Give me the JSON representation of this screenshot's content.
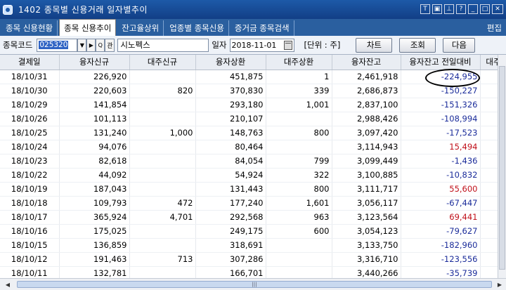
{
  "window": {
    "title": "1402 종목별 신용거래 일자별추이"
  },
  "tabs": [
    {
      "label": "종목 신용현황"
    },
    {
      "label": "종목 신용추이"
    },
    {
      "label": "잔고율상위"
    },
    {
      "label": "업종별 종목신용"
    },
    {
      "label": "증거금 종목검색"
    }
  ],
  "tab_right": "편집",
  "query": {
    "code_label": "종목코드",
    "code_value": "025320",
    "search_btn": "Q",
    "related_btn": "관",
    "stock_name": "시노펙스",
    "date_label": "일자",
    "date_value": "2018-11-01",
    "unit_text": "[단위 : 주]",
    "chart_btn": "차트",
    "query_btn": "조회",
    "next_btn": "다음"
  },
  "table": {
    "headers": [
      "결제일",
      "융자신규",
      "대주신규",
      "융자상환",
      "대주상환",
      "융자잔고",
      "융자잔고 전일대비",
      "대주"
    ],
    "rows": [
      {
        "date": "18/10/31",
        "loan_new": "226,920",
        "short_new": "",
        "loan_repay": "451,875",
        "short_repay": "1",
        "balance": "2,461,918",
        "change": "-224,955",
        "sign": "neg"
      },
      {
        "date": "18/10/30",
        "loan_new": "220,603",
        "short_new": "820",
        "loan_repay": "370,830",
        "short_repay": "339",
        "balance": "2,686,873",
        "change": "-150,227",
        "sign": "neg"
      },
      {
        "date": "18/10/29",
        "loan_new": "141,854",
        "short_new": "",
        "loan_repay": "293,180",
        "short_repay": "1,001",
        "balance": "2,837,100",
        "change": "-151,326",
        "sign": "neg"
      },
      {
        "date": "18/10/26",
        "loan_new": "101,113",
        "short_new": "",
        "loan_repay": "210,107",
        "short_repay": "",
        "balance": "2,988,426",
        "change": "-108,994",
        "sign": "neg"
      },
      {
        "date": "18/10/25",
        "loan_new": "131,240",
        "short_new": "1,000",
        "loan_repay": "148,763",
        "short_repay": "800",
        "balance": "3,097,420",
        "change": "-17,523",
        "sign": "neg"
      },
      {
        "date": "18/10/24",
        "loan_new": "94,076",
        "short_new": "",
        "loan_repay": "80,464",
        "short_repay": "",
        "balance": "3,114,943",
        "change": "15,494",
        "sign": "pos"
      },
      {
        "date": "18/10/23",
        "loan_new": "82,618",
        "short_new": "",
        "loan_repay": "84,054",
        "short_repay": "799",
        "balance": "3,099,449",
        "change": "-1,436",
        "sign": "neg"
      },
      {
        "date": "18/10/22",
        "loan_new": "44,092",
        "short_new": "",
        "loan_repay": "54,924",
        "short_repay": "322",
        "balance": "3,100,885",
        "change": "-10,832",
        "sign": "neg"
      },
      {
        "date": "18/10/19",
        "loan_new": "187,043",
        "short_new": "",
        "loan_repay": "131,443",
        "short_repay": "800",
        "balance": "3,111,717",
        "change": "55,600",
        "sign": "pos"
      },
      {
        "date": "18/10/18",
        "loan_new": "109,793",
        "short_new": "472",
        "loan_repay": "177,240",
        "short_repay": "1,601",
        "balance": "3,056,117",
        "change": "-67,447",
        "sign": "neg"
      },
      {
        "date": "18/10/17",
        "loan_new": "365,924",
        "short_new": "4,701",
        "loan_repay": "292,568",
        "short_repay": "963",
        "balance": "3,123,564",
        "change": "69,441",
        "sign": "pos"
      },
      {
        "date": "18/10/16",
        "loan_new": "175,025",
        "short_new": "",
        "loan_repay": "249,175",
        "short_repay": "600",
        "balance": "3,054,123",
        "change": "-79,627",
        "sign": "neg"
      },
      {
        "date": "18/10/15",
        "loan_new": "136,859",
        "short_new": "",
        "loan_repay": "318,691",
        "short_repay": "",
        "balance": "3,133,750",
        "change": "-182,960",
        "sign": "neg"
      },
      {
        "date": "18/10/12",
        "loan_new": "191,463",
        "short_new": "713",
        "loan_repay": "307,286",
        "short_repay": "",
        "balance": "3,316,710",
        "change": "-123,556",
        "sign": "neg"
      },
      {
        "date": "18/10/11",
        "loan_new": "132,781",
        "short_new": "",
        "loan_repay": "166,701",
        "short_repay": "",
        "balance": "3,440,266",
        "change": "-35,739",
        "sign": "neg"
      }
    ]
  },
  "colors": {
    "negative": "#1b2c9a",
    "positive": "#c0101a",
    "title_bar": "#1d5aa8"
  }
}
